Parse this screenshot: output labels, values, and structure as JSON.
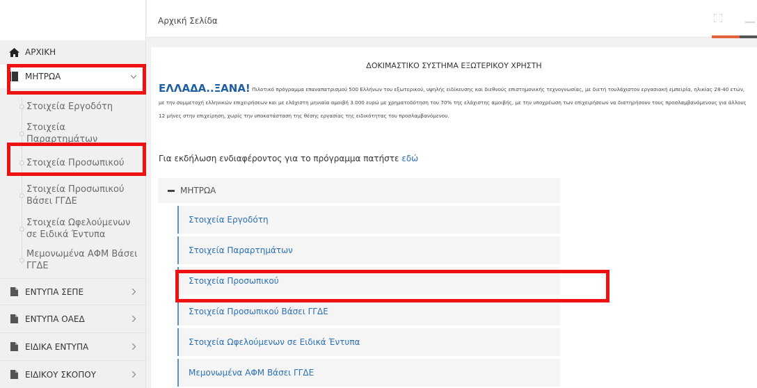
{
  "header": {
    "title": "Αρχική Σελίδα"
  },
  "sidebar": {
    "home": "ΑΡΧΙΚΗ",
    "mitroa": "ΜΗΤΡΩΑ",
    "sub_items": [
      "Στοιχεία Εργοδότη",
      "Στοιχεία Παραρτημάτων",
      "Στοιχεία Προσωπικού",
      "Στοιχεία Προσωπικού Βάσει ΓΓΔΕ",
      "Στοιχεία Ωφελούμενων σε Ειδικά Έντυπα",
      "Μεμονωμένα ΑΦΜ Βάσει ΓΓΔΕ"
    ],
    "sections": [
      "ΕΝΤΥΠΑ ΣΕΠΕ",
      "ΕΝΤΥΠΑ ΟΑΕΔ",
      "ΕΙΔΙΚΑ ΕΝΤΥΠΑ",
      "ΕΙΔΙΚΟΥ ΣΚΟΠΟΥ"
    ]
  },
  "content": {
    "title": "ΔΟΚΙΜΑΣΤΙΚΟ ΣΥΣΤΗΜΑ ΕΞΩΤΕΡΙΚΟΥ ΧΡΗΣΤΗ",
    "brand": "ΕΛΛΑΔΑ..ΞΑΝΑ!",
    "intro_text": "Πιλοτικό πρόγραμμα επαναπατρισμού 500 Ελλήνων του εξωτερικού, υψηλής ειδίκευσης και διεθνούς επιστημονικής τεχνογνωσίας, με διετή τουλάχιστον εργασιακή εμπειρία, ηλικίας 28-40 ετών, με την συμμετοχή ελληνικών επιχειρήσεων και με ελάχιστη μηνιαία αμοιβή 3.000 ευρώ με χρηματοδότηση του 70% της ελάχιστης αμοιβής, με την υποχρέωση των επιχειρήσεων να διατηρήσουν τους προσλαμβανόμενους για άλλους 12 μήνες στην επιχείρηση, χωρίς την υποκατάσταση της θέσης εργασίας της ειδικότητας του προσλαμβανόμενου.",
    "cta_text": "Για εκδήλωση ενδιαφέροντος για το πρόγραμμα πατήστε",
    "cta_link": "εδώ",
    "tree_header": "ΜΗΤΡΩΑ",
    "tree_items": [
      "Στοιχεία Εργοδότη",
      "Στοιχεία Παραρτημάτων",
      "Στοιχεία Προσωπικού",
      "Στοιχεία Προσωπικού Βάσει ΓΓΔΕ",
      "Στοιχεία Ωφελούμενων σε Ειδικά Έντυπα",
      "Μεμονωμένα ΑΦΜ Βάσει ΓΓΔΕ"
    ]
  },
  "colors": {
    "highlight": "#ee1111",
    "link": "#2a6fb5",
    "brand": "#1e5fa5",
    "tab_accent": "#e4613b"
  },
  "icons": {
    "home": "home-icon",
    "book": "book-icon",
    "file": "file-icon",
    "chevron_down": "chevron-down-icon",
    "chevron_right": "chevron-right-icon"
  }
}
